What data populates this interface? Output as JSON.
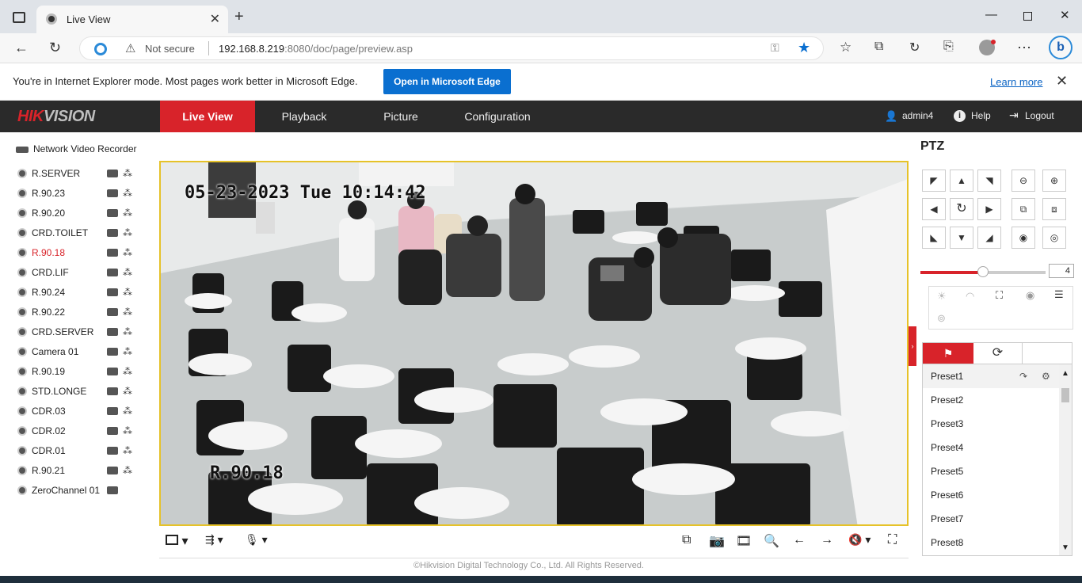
{
  "browser": {
    "tab_title": "Live View",
    "security": "Not secure",
    "url_host": "192.168.8.219",
    "url_rest": ":8080/doc/page/preview.asp",
    "ie_message": "You're in Internet Explorer mode. Most pages work better in Microsoft Edge.",
    "ie_button": "Open in Microsoft Edge",
    "learn_more": "Learn more"
  },
  "header": {
    "logo_red": "HIK",
    "logo_gray": "VISION",
    "nav": [
      "Live View",
      "Playback",
      "Picture",
      "Configuration"
    ],
    "active_nav": "Live View",
    "user": "admin4",
    "help": "Help",
    "logout": "Logout"
  },
  "tree": {
    "root": "Network Video Recorder",
    "cameras": [
      "R.SERVER",
      "R.90.23",
      "R.90.20",
      "CRD.TOILET",
      "R.90.18",
      "CRD.LIF",
      "R.90.24",
      "R.90.22",
      "CRD.SERVER",
      "Camera 01",
      "R.90.19",
      "STD.LONGE",
      "CDR.03",
      "CDR.02",
      "CDR.01",
      "R.90.21",
      "ZeroChannel 01"
    ],
    "selected": "R.90.18"
  },
  "video": {
    "osd_time": "05-23-2023 Tue 10:14:42",
    "osd_name": "R.90.18"
  },
  "ptz": {
    "title": "PTZ",
    "speed": "4",
    "speed_fraction": 0.5,
    "presets": [
      "Preset1",
      "Preset2",
      "Preset3",
      "Preset4",
      "Preset5",
      "Preset6",
      "Preset7",
      "Preset8"
    ]
  },
  "footer": "©Hikvision Digital Technology Co., Ltd. All Rights Reserved."
}
